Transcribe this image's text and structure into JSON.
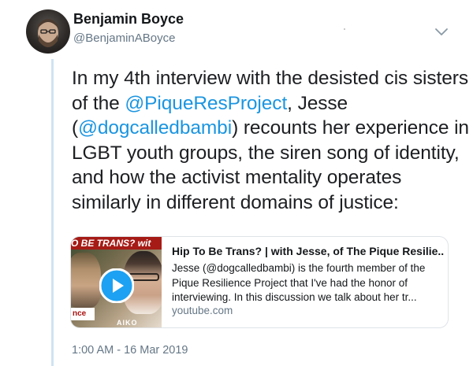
{
  "author": {
    "display_name": "Benjamin Boyce",
    "handle": "@BenjaminABoyce"
  },
  "tweet": {
    "segments": [
      {
        "text": "In my 4th interview with the desisted cis sisters of the ",
        "type": "text"
      },
      {
        "text": "@PiqueResProject",
        "type": "link"
      },
      {
        "text": ", Jesse (",
        "type": "text"
      },
      {
        "text": "@dogcalledbambi",
        "type": "link"
      },
      {
        "text": ") recounts her experience in LGBT youth groups, the siren song of identity, and how the activist mentality operates similarly in different domains of justice:",
        "type": "text"
      }
    ]
  },
  "card": {
    "title": "Hip To Be Trans? | with Jesse, of The Pique Resilie...",
    "description": "Jesse (@dogcalledbambi) is the fourth member of the Pique Resilience Project that I've had the honor of interviewing. In this discussion we talk about her tr...",
    "domain": "youtube.com",
    "thumbnail": {
      "banner_text": "O BE TRANS? wit",
      "bottom_text": "nce",
      "brand_text": "AIKO"
    }
  },
  "timestamp": "1:00 AM - 16 Mar 2019",
  "icons": {
    "more": "chevron-down-icon",
    "play": "play-icon"
  },
  "colors": {
    "link": "#1b95e0",
    "secondary": "#657786",
    "thread_line": "#cfe3f2",
    "banner": "#a61b16",
    "play_button": "#1da1f2"
  }
}
